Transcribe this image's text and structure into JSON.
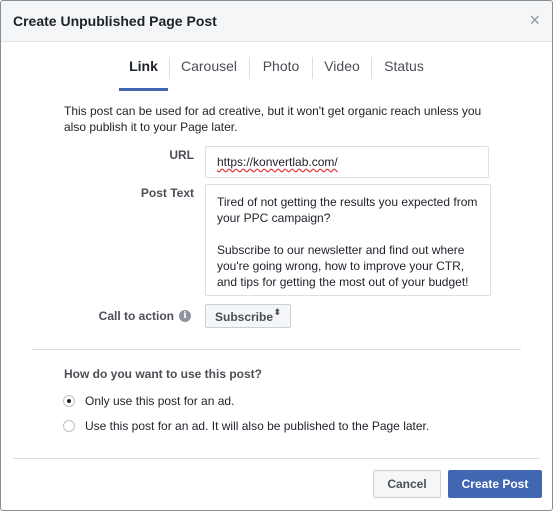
{
  "dialog": {
    "title": "Create Unpublished Page Post",
    "close_glyph": "×"
  },
  "tabs": [
    {
      "label": "Link",
      "active": true
    },
    {
      "label": "Carousel",
      "active": false
    },
    {
      "label": "Photo",
      "active": false
    },
    {
      "label": "Video",
      "active": false
    },
    {
      "label": "Status",
      "active": false
    }
  ],
  "notice": "This post can be used for ad creative, but it won't get organic reach unless you also publish it to your Page later.",
  "form": {
    "url_label": "URL",
    "url_value": "https://konvertlab.com/",
    "post_text_label": "Post Text",
    "post_text_para1": "Tired of not getting the results you expected from your PPC campaign?",
    "post_text_para2": "Subscribe to our newsletter and find out where you're going wrong, how to improve your CTR, and tips for getting the most out of your budget!",
    "cta_label": "Call to action",
    "cta_value": "Subscribe",
    "cta_caret": "⬍"
  },
  "usage": {
    "question": "How do you want to use this post?",
    "options": [
      {
        "label": "Only use this post for an ad.",
        "selected": true
      },
      {
        "label": "Use this post for an ad. It will also be published to the Page later.",
        "selected": false
      }
    ]
  },
  "footer": {
    "cancel_label": "Cancel",
    "create_label": "Create Post"
  },
  "colors": {
    "accent": "#4267b2",
    "header_bg": "#f5f6f7"
  },
  "icons": {
    "info": "info-icon",
    "close": "close-icon"
  }
}
